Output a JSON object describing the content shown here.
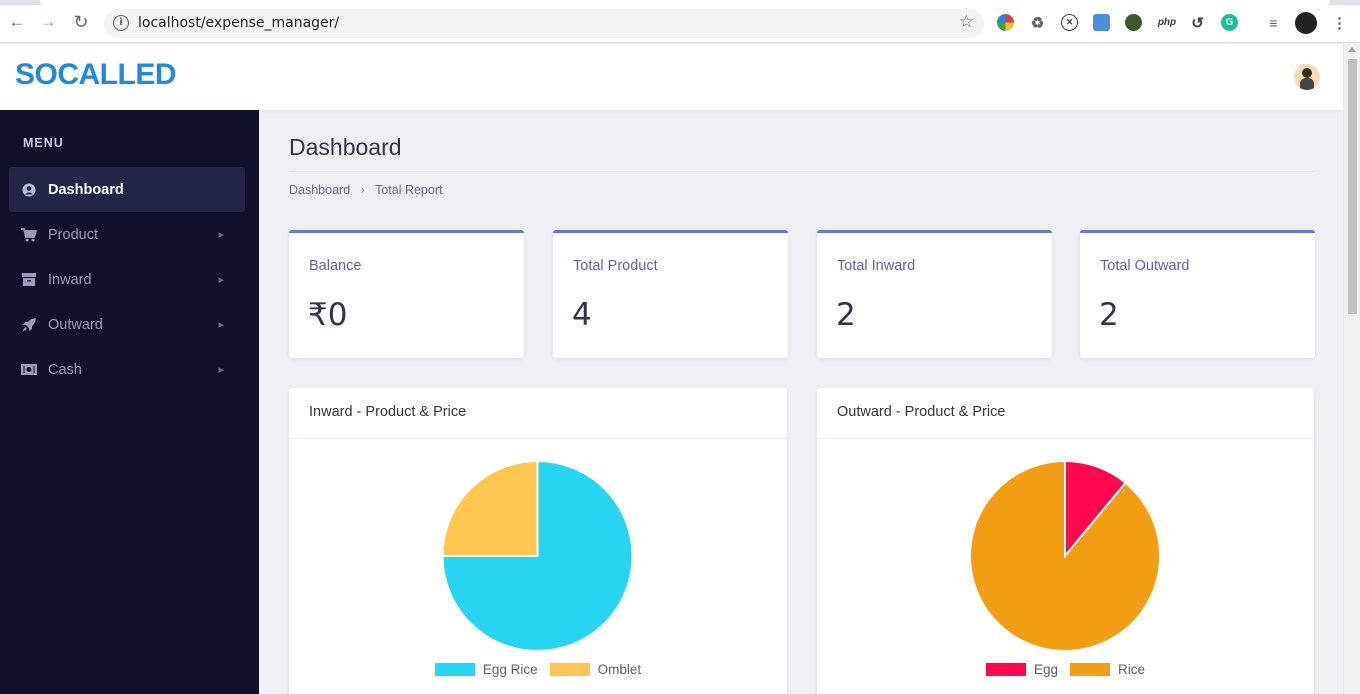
{
  "browser": {
    "url": "localhost/expense_manager/"
  },
  "header": {
    "brand": "SOCALLED"
  },
  "sidebar": {
    "menu_title": "MENU",
    "items": [
      {
        "label": "Dashboard",
        "icon": "user-circle-icon",
        "active": true
      },
      {
        "label": "Product",
        "icon": "cart-icon",
        "active": false
      },
      {
        "label": "Inward",
        "icon": "archive-icon",
        "active": false
      },
      {
        "label": "Outward",
        "icon": "rocket-icon",
        "active": false
      },
      {
        "label": "Cash",
        "icon": "money-icon",
        "active": false
      }
    ]
  },
  "main": {
    "title": "Dashboard",
    "breadcrumb": [
      "Dashboard",
      "Total Report"
    ],
    "stats": [
      {
        "label": "Balance",
        "value": "₹0"
      },
      {
        "label": "Total Product",
        "value": "4"
      },
      {
        "label": "Total Inward",
        "value": "2"
      },
      {
        "label": "Total Outward",
        "value": "2"
      }
    ]
  },
  "chart_data": [
    {
      "type": "pie",
      "title": "Inward - Product & Price",
      "categories": [
        "Egg Rice",
        "Omblet"
      ],
      "values": [
        75,
        25
      ],
      "colors": [
        "#26d6f0",
        "#fec64f"
      ]
    },
    {
      "type": "pie",
      "title": "Outward - Product & Price",
      "categories": [
        "Egg",
        "Rice"
      ],
      "values": [
        11,
        89
      ],
      "colors": [
        "#ff0850",
        "#f19e13"
      ]
    }
  ]
}
